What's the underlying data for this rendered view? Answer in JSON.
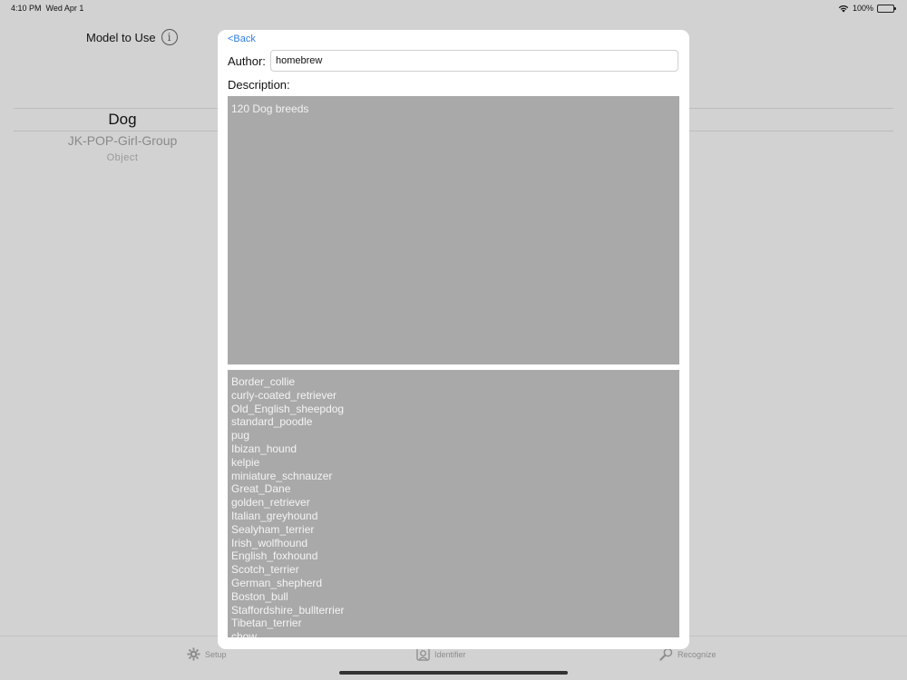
{
  "status_bar": {
    "time": "4:10 PM",
    "date": "Wed Apr 1",
    "battery": "100%"
  },
  "main": {
    "model_label": "Model to Use",
    "picker": {
      "selected": "Dog",
      "items": [
        "JK-POP-Girl-Group",
        "Object"
      ]
    }
  },
  "tabs": [
    {
      "label": "Setup",
      "icon": "gear-icon"
    },
    {
      "label": "Identifier",
      "icon": "identifier-icon"
    },
    {
      "label": "Recognize",
      "icon": "recognize-icon"
    }
  ],
  "modal": {
    "back_label": "<Back",
    "author_label": "Author:",
    "author_value": "homebrew",
    "description_label": "Description:",
    "description_text": "120 Dog breeds",
    "labels": [
      "Border_collie",
      "curly-coated_retriever",
      "Old_English_sheepdog",
      "standard_poodle",
      "pug",
      "Ibizan_hound",
      "kelpie",
      "miniature_schnauzer",
      "Great_Dane",
      "golden_retriever",
      "Italian_greyhound",
      "Sealyham_terrier",
      "Irish_wolfhound",
      "English_foxhound",
      "Scotch_terrier",
      "German_shepherd",
      "Boston_bull",
      "Staffordshire_bullterrier",
      "Tibetan_terrier",
      "chow"
    ]
  },
  "colors": {
    "accent": "#2f7de1",
    "overlay": "#d2d2d2",
    "text_area": "#a9a9a9"
  }
}
